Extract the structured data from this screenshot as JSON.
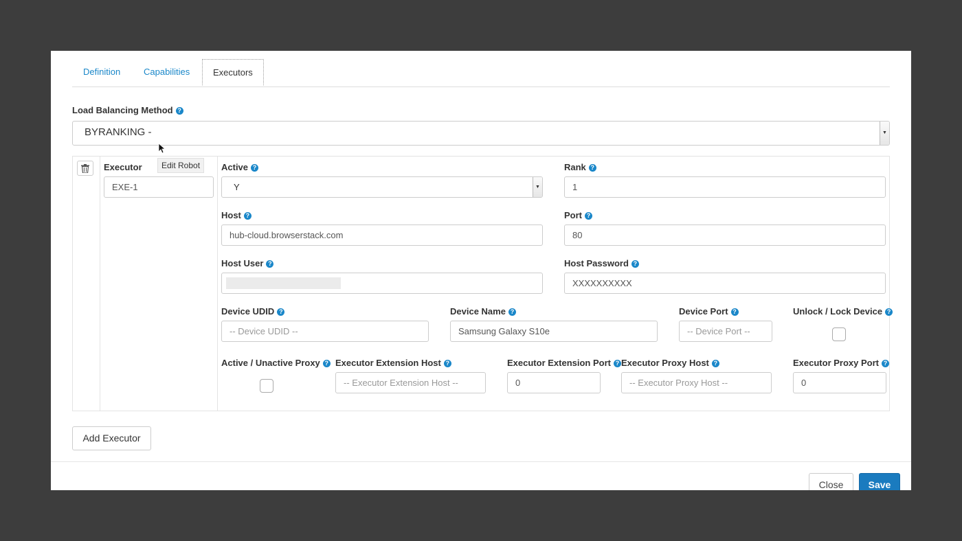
{
  "tabs": [
    {
      "label": "Definition"
    },
    {
      "label": "Capabilities"
    },
    {
      "label": "Executors"
    }
  ],
  "load_balancing": {
    "label": "Load Balancing Method",
    "value": "BYRANKING -"
  },
  "tooltip": "Edit Robot",
  "executor": {
    "label": "Executor",
    "value": "EXE-1",
    "active": {
      "label": "Active",
      "value": "Y"
    },
    "rank": {
      "label": "Rank",
      "value": "1"
    },
    "host": {
      "label": "Host",
      "value": "hub-cloud.browserstack.com"
    },
    "port": {
      "label": "Port",
      "value": "80"
    },
    "host_user": {
      "label": "Host User",
      "value": ""
    },
    "host_password": {
      "label": "Host Password",
      "value": "XXXXXXXXXX"
    },
    "device_udid": {
      "label": "Device UDID",
      "placeholder": "-- Device UDID --"
    },
    "device_name": {
      "label": "Device Name",
      "value": "Samsung Galaxy S10e"
    },
    "device_port": {
      "label": "Device Port",
      "placeholder": "-- Device Port --"
    },
    "unlock_lock": {
      "label": "Unlock / Lock Device"
    },
    "active_proxy": {
      "label": "Active / Unactive Proxy"
    },
    "ext_host": {
      "label": "Executor Extension Host",
      "placeholder": "-- Executor Extension Host --"
    },
    "ext_port": {
      "label": "Executor Extension Port",
      "value": "0"
    },
    "proxy_host": {
      "label": "Executor Proxy Host",
      "placeholder": "-- Executor Proxy Host --"
    },
    "proxy_port": {
      "label": "Executor Proxy Port",
      "value": "0"
    }
  },
  "buttons": {
    "add_executor": "Add Executor",
    "close": "Close",
    "save": "Save"
  },
  "help_glyph": "?",
  "select_arrow_glyph": "▼",
  "colors": {
    "accent": "#1a87c9",
    "save": "#1a7bbf"
  }
}
